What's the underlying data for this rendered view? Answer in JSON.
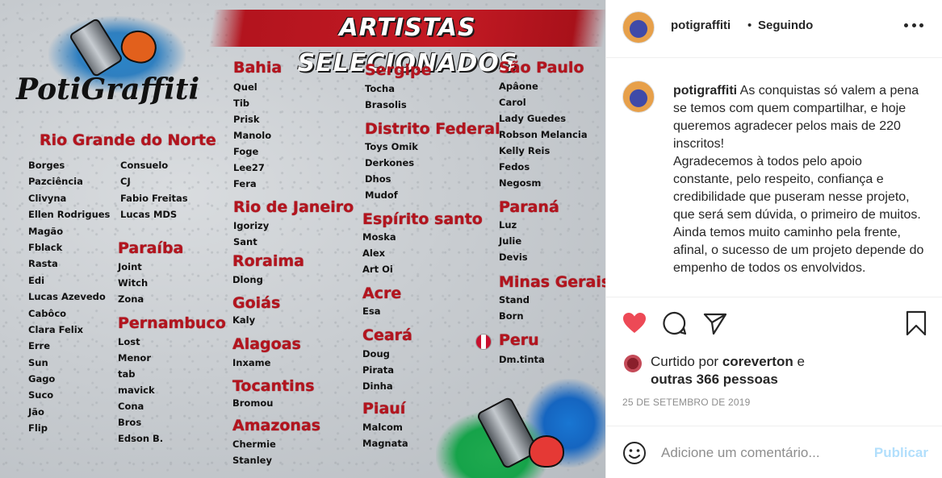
{
  "poster": {
    "banner_title": "ARTISTAS SELECIONADOS",
    "logo_text": "PotiGraffiti",
    "regions": [
      {
        "id": "rn",
        "name": "Rio Grande do Norte",
        "artists_col1": [
          "Borges",
          "Pazciência",
          "Clivyna",
          "Ellen Rodrigues",
          "Magão",
          "Fblack",
          "Rasta",
          "Edi",
          "Lucas Azevedo",
          "Cabôco",
          "Clara Felix",
          "Erre",
          "Sun",
          "Gago",
          "Suco",
          "Jão",
          "Flip"
        ],
        "artists_col2": [
          "Consuelo",
          "CJ",
          "Fabio Freitas",
          "Lucas MDS"
        ]
      },
      {
        "id": "pb",
        "name": "Paraíba",
        "artists": [
          "Joint",
          "Witch",
          "Zona"
        ]
      },
      {
        "id": "pe",
        "name": "Pernambuco",
        "artists": [
          "Lost",
          "Menor",
          "tab",
          "mavick",
          "Cona",
          "Bros",
          "Edson B."
        ]
      },
      {
        "id": "ba",
        "name": "Bahia",
        "artists": [
          "Quel",
          "Tib",
          "Prisk",
          "Manolo",
          "Foge",
          "Lee27",
          "Fera"
        ]
      },
      {
        "id": "rj",
        "name": "Rio de Janeiro",
        "artists": [
          "Igorizy",
          "Sant"
        ]
      },
      {
        "id": "rr",
        "name": "Roraima",
        "artists": [
          "Dlong"
        ]
      },
      {
        "id": "go",
        "name": "Goiás",
        "artists": [
          "Kaly"
        ]
      },
      {
        "id": "al",
        "name": "Alagoas",
        "artists": [
          "Inxame"
        ]
      },
      {
        "id": "to",
        "name": "Tocantins",
        "artists": [
          "Bromou"
        ]
      },
      {
        "id": "am",
        "name": "Amazonas",
        "artists": [
          "Chermie",
          "Stanley"
        ]
      },
      {
        "id": "se",
        "name": "Sergipe",
        "artists": [
          "Tocha",
          "Brasolis"
        ]
      },
      {
        "id": "df",
        "name": "Distrito Federal",
        "artists": [
          "Toys Omik",
          "Derkones",
          "Dhos",
          "Mudof"
        ]
      },
      {
        "id": "es",
        "name": "Espírito santo",
        "artists": [
          "Moska",
          "Alex",
          "Art Oi"
        ]
      },
      {
        "id": "ac",
        "name": "Acre",
        "artists": [
          "Esa"
        ]
      },
      {
        "id": "ce",
        "name": "Ceará",
        "artists": [
          "Doug",
          "Pirata",
          "Dinha"
        ]
      },
      {
        "id": "pi",
        "name": "Piauí",
        "artists": [
          "Malcom",
          "Magnata"
        ]
      },
      {
        "id": "sp",
        "name": "São Paulo",
        "artists": [
          "Apâone",
          "Carol",
          "Lady Guedes",
          "Robson Melancia",
          "Kelly Reis",
          "Fedos",
          "Negosm"
        ]
      },
      {
        "id": "pr",
        "name": "Paraná",
        "artists": [
          "Luz",
          "Julie",
          "Devis"
        ]
      },
      {
        "id": "mg",
        "name": "Minas Gerais",
        "artists": [
          "Stand",
          "Born"
        ]
      },
      {
        "id": "peru",
        "name": "Peru",
        "artists": [
          "Dm.tinta"
        ]
      }
    ]
  },
  "header": {
    "username": "potigraffiti",
    "separator": "•",
    "follow_label": "Seguindo"
  },
  "caption": {
    "username": "potigraffiti",
    "text_1": "As conquistas só valem a pena se temos com quem compartilhar, e hoje queremos agradecer pelos mais de 220 inscritos!",
    "text_2": "Agradecemos à todos pelo apoio constante, pelo respeito, confiança e credibilidade que puseram nesse projeto, que será sem dúvida, o primeiro de muitos.",
    "text_3": "Ainda temos muito caminho pela frente, afinal, o sucesso de um projeto depende do empenho de todos os envolvidos."
  },
  "likes": {
    "prefix": "Curtido por",
    "liker": "coreverton",
    "conj": "e",
    "others": "outras 366 pessoas"
  },
  "date": "25 DE SETEMBRO DE 2019",
  "comment": {
    "placeholder": "Adicione um comentário...",
    "publish_label": "Publicar"
  },
  "colors": {
    "heart": "#ed4956",
    "publish_disabled": "#b2dffc",
    "region_red": "#b3141e"
  }
}
